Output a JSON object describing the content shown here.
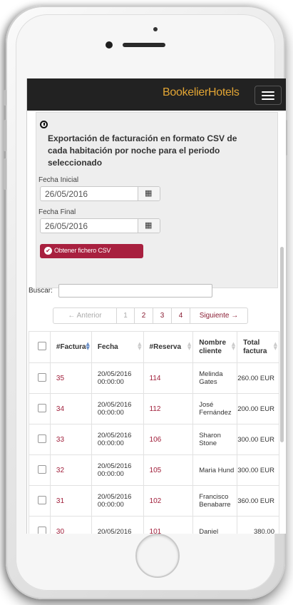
{
  "app": {
    "brand": "BookelierHotels"
  },
  "export": {
    "title": "Exportación de facturación en formato CSV de cada habitación por noche para el periodo seleccionado",
    "start_label": "Fecha Inicial",
    "start_value": "26/05/2016",
    "end_label": "Fecha Final",
    "end_value": "26/05/2016",
    "button_label": "Obtener fichero CSV",
    "button_color": "#a8203f"
  },
  "search": {
    "label": "Buscar:",
    "value": ""
  },
  "pagination": {
    "prev": "← Anterior",
    "pages": [
      "1",
      "2",
      "3",
      "4"
    ],
    "current": "1",
    "next": "Siguiente →"
  },
  "table": {
    "headers": [
      "",
      "#Factura",
      "Fecha",
      "#Reserva",
      "Nombre cliente",
      "Total factura"
    ],
    "rows": [
      {
        "factura": "35",
        "fecha": "20/05/2016 00:00:00",
        "reserva": "114",
        "cliente": "Melinda Gates",
        "total": "260.00 EUR"
      },
      {
        "factura": "34",
        "fecha": "20/05/2016 00:00:00",
        "reserva": "112",
        "cliente": "José Fernández",
        "total": "200.00 EUR"
      },
      {
        "factura": "33",
        "fecha": "20/05/2016 00:00:00",
        "reserva": "106",
        "cliente": "Sharon Stone",
        "total": "300.00 EUR"
      },
      {
        "factura": "32",
        "fecha": "20/05/2016 00:00:00",
        "reserva": "105",
        "cliente": "Maria Hund",
        "total": "300.00 EUR"
      },
      {
        "factura": "31",
        "fecha": "20/05/2016 00:00:00",
        "reserva": "102",
        "cliente": "Francisco Benabarre",
        "total": "360.00 EUR"
      },
      {
        "factura": "30",
        "fecha": "20/05/2016",
        "reserva": "101",
        "cliente": "Daniel",
        "total": "380.00"
      }
    ]
  },
  "colors": {
    "navbar": "#222222",
    "brand": "#e2a534",
    "link": "#a01e3a"
  }
}
